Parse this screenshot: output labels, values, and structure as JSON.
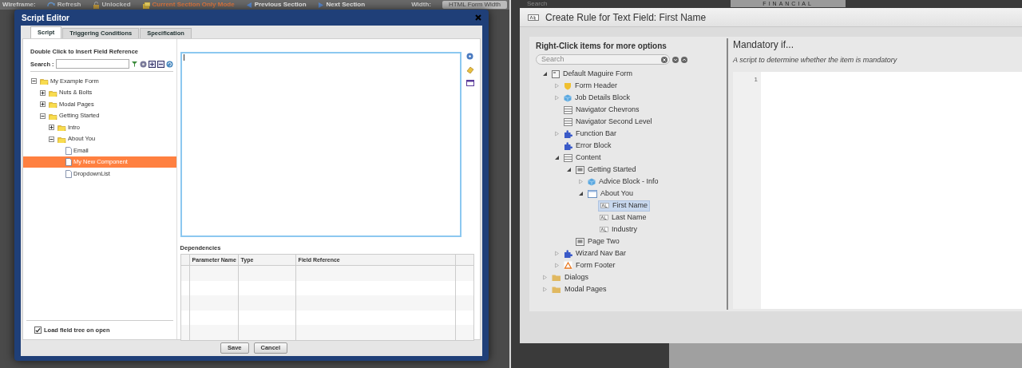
{
  "left": {
    "toolbar": [
      {
        "kind": "label",
        "text": "Wireframe:"
      },
      {
        "kind": "refresh",
        "text": "Refresh"
      },
      {
        "kind": "lock",
        "text": "Unlocked"
      },
      {
        "kind": "mode",
        "text": "Current Section Only Mode"
      },
      {
        "kind": "prev",
        "text": "Previous Section"
      },
      {
        "kind": "next",
        "text": "Next Section"
      }
    ],
    "width_label": "Width:",
    "width_value": "HTML Form Width",
    "dialog": {
      "title": "Script Editor",
      "tabs": [
        {
          "label": "Script",
          "selected": true
        },
        {
          "label": "Triggering Conditions",
          "selected": false
        },
        {
          "label": "Specification",
          "selected": false
        }
      ],
      "tree_hint": "Double Click to Insert Field Reference",
      "search_label": "Search :",
      "tree": [
        {
          "label": "My Example Form",
          "kind": "folder",
          "expanded": true,
          "selected": false,
          "children": [
            {
              "label": "Nuts & Bolts",
              "kind": "folder",
              "expanded": false,
              "selected": false
            },
            {
              "label": "Modal Pages",
              "kind": "folder",
              "expanded": false,
              "selected": false
            },
            {
              "label": "Getting Started",
              "kind": "folder",
              "expanded": true,
              "selected": false,
              "children": [
                {
                  "label": "Intro",
                  "kind": "folder",
                  "expanded": false,
                  "selected": false
                },
                {
                  "label": "About You",
                  "kind": "folder",
                  "expanded": true,
                  "selected": false,
                  "children": [
                    {
                      "label": "Email",
                      "kind": "file",
                      "selected": false
                    },
                    {
                      "label": "My New Component",
                      "kind": "file",
                      "selected": true
                    },
                    {
                      "label": "DropdownList",
                      "kind": "file",
                      "selected": false
                    }
                  ]
                }
              ]
            }
          ]
        }
      ],
      "load_option": {
        "label": "Load field tree on open",
        "checked": true
      },
      "dependencies": {
        "title": "Dependencies",
        "columns": [
          "Parameter Name",
          "Type",
          "Field Reference"
        ]
      },
      "buttons": [
        "Save",
        "Cancel"
      ]
    }
  },
  "right": {
    "background_search": "Search",
    "background_logo": "FINANCIAL",
    "dialog": {
      "title": "Create Rule for Text Field: First Name",
      "tree_title": "Right-Click items for more options",
      "search_placeholder": "Search",
      "tree": [
        {
          "label": "Default Maguire Form",
          "kind": "form",
          "expanded": true,
          "selected": false,
          "children": [
            {
              "label": "Form Header",
              "kind": "shield",
              "expanded": false,
              "selected": false
            },
            {
              "label": "Job Details Block",
              "kind": "cube",
              "expanded": false,
              "selected": false
            },
            {
              "label": "Navigator Chevrons",
              "kind": "bar",
              "selected": false
            },
            {
              "label": "Navigator Second Level",
              "kind": "bar",
              "selected": false
            },
            {
              "label": "Function Bar",
              "kind": "puzzle",
              "expanded": false,
              "selected": false
            },
            {
              "label": "Error Block",
              "kind": "puzzle",
              "selected": false
            },
            {
              "label": "Content",
              "kind": "bar",
              "expanded": true,
              "selected": false,
              "children": [
                {
                  "label": "Getting Started",
                  "kind": "page",
                  "expanded": true,
                  "selected": false,
                  "children": [
                    {
                      "label": "Advice Block - Info",
                      "kind": "cube",
                      "expanded": false,
                      "selected": false
                    },
                    {
                      "label": "About You",
                      "kind": "panel",
                      "expanded": true,
                      "selected": false,
                      "children": [
                        {
                          "label": "First Name",
                          "kind": "text",
                          "selected": true
                        },
                        {
                          "label": "Last Name",
                          "kind": "text",
                          "selected": false
                        },
                        {
                          "label": "Industry",
                          "kind": "text",
                          "selected": false
                        }
                      ]
                    }
                  ]
                },
                {
                  "label": "Page Two",
                  "kind": "page",
                  "selected": false
                }
              ]
            },
            {
              "label": "Wizard Nav Bar",
              "kind": "puzzle",
              "expanded": false,
              "selected": false
            },
            {
              "label": "Form Footer",
              "kind": "warning",
              "expanded": false,
              "selected": false
            }
          ]
        },
        {
          "label": "Dialogs",
          "kind": "folder",
          "expanded": false,
          "selected": false
        },
        {
          "label": "Modal Pages",
          "kind": "folder",
          "expanded": false,
          "selected": false
        }
      ],
      "rule_title": "Mandatory if...",
      "rule_hint": "A script to determine whether the item is mandatory",
      "line_number": "1"
    }
  }
}
